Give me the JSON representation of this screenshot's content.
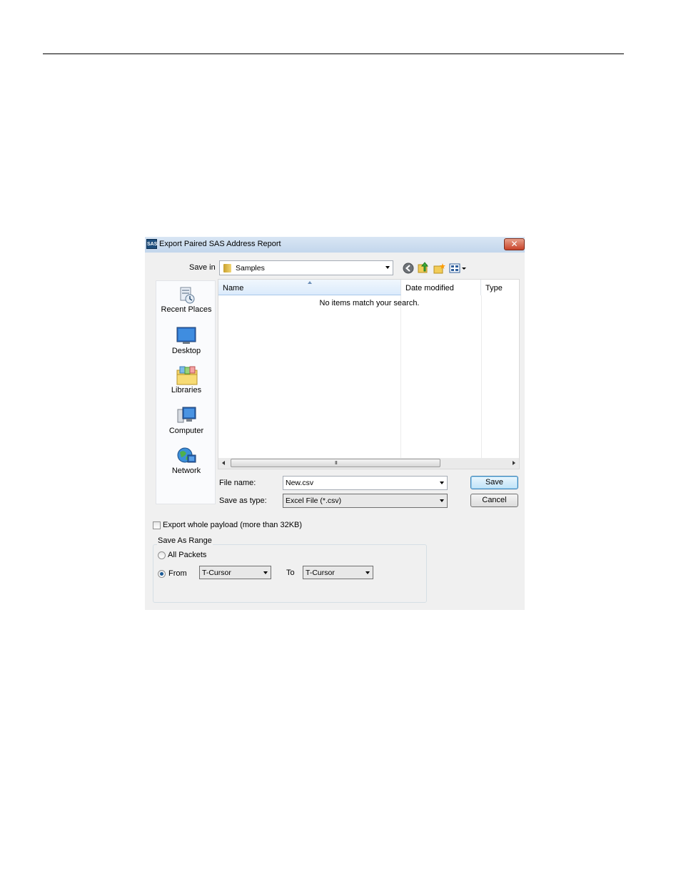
{
  "dialog": {
    "app_icon_text": "SAS",
    "title": "Export Paired SAS Address Report",
    "close_glyph": "✕"
  },
  "save_in": {
    "label": "Save in",
    "value": "Samples"
  },
  "toolbar_icons": [
    "back-icon",
    "up-folder-icon",
    "new-folder-icon",
    "view-menu-icon"
  ],
  "places": [
    {
      "label": "Recent Places",
      "icon": "recent-places-icon"
    },
    {
      "label": "Desktop",
      "icon": "desktop-icon"
    },
    {
      "label": "Libraries",
      "icon": "libraries-icon"
    },
    {
      "label": "Computer",
      "icon": "computer-icon"
    },
    {
      "label": "Network",
      "icon": "network-icon"
    }
  ],
  "file_list": {
    "columns": [
      "Name",
      "Date modified",
      "Type"
    ],
    "empty_message": "No items match your search.",
    "scroll_grip": "III"
  },
  "file_name": {
    "label": "File name:",
    "value": "New.csv"
  },
  "save_as_type": {
    "label": "Save as type:",
    "value": "Excel File (*.csv)"
  },
  "buttons": {
    "save": "Save",
    "cancel": "Cancel"
  },
  "export_payload": {
    "label": "Export whole payload (more than 32KB)",
    "checked": false
  },
  "range": {
    "group_label": "Save As Range",
    "all_packets_label": "All Packets",
    "from_label": "From",
    "from_value": "T-Cursor",
    "to_label": "To",
    "to_value": "T-Cursor",
    "selected": "From"
  },
  "colors": {
    "accent": "#3c7fb1",
    "dialog_bg": "#f0f0f0",
    "close_red": "#c8432a"
  }
}
